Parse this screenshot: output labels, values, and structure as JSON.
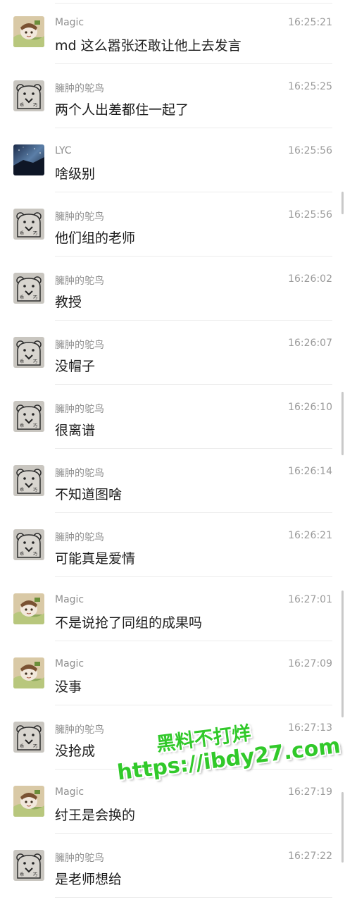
{
  "messages": [
    {
      "sender": "Magic",
      "time": "16:25:21",
      "text": "md 这么嚣张还敢让他上去发言",
      "avatar": "anime-avatar"
    },
    {
      "sender": "臃肿的鸵鸟",
      "time": "16:25:25",
      "text": "两个人出差都住一起了",
      "avatar": "bear-avatar"
    },
    {
      "sender": "LYC",
      "time": "16:25:56",
      "text": "啥级别",
      "avatar": "galaxy-avatar"
    },
    {
      "sender": "臃肿的鸵鸟",
      "time": "16:25:56",
      "text": "他们组的老师",
      "avatar": "bear-avatar"
    },
    {
      "sender": "臃肿的鸵鸟",
      "time": "16:26:02",
      "text": "教授",
      "avatar": "bear-avatar"
    },
    {
      "sender": "臃肿的鸵鸟",
      "time": "16:26:07",
      "text": "没帽子",
      "avatar": "bear-avatar"
    },
    {
      "sender": "臃肿的鸵鸟",
      "time": "16:26:10",
      "text": "很离谱",
      "avatar": "bear-avatar"
    },
    {
      "sender": "臃肿的鸵鸟",
      "time": "16:26:14",
      "text": "不知道图啥",
      "avatar": "bear-avatar"
    },
    {
      "sender": "臃肿的鸵鸟",
      "time": "16:26:21",
      "text": "可能真是爱情",
      "avatar": "bear-avatar"
    },
    {
      "sender": "Magic",
      "time": "16:27:01",
      "text": "不是说抢了同组的成果吗",
      "avatar": "anime-avatar"
    },
    {
      "sender": "Magic",
      "time": "16:27:09",
      "text": "没事",
      "avatar": "anime-avatar"
    },
    {
      "sender": "臃肿的鸵鸟",
      "time": "16:27:13",
      "text": "没抢成",
      "avatar": "bear-avatar"
    },
    {
      "sender": "Magic",
      "time": "16:27:19",
      "text": "纣王是会换的",
      "avatar": "anime-avatar"
    },
    {
      "sender": "臃肿的鸵鸟",
      "time": "16:27:22",
      "text": "是老师想给",
      "avatar": "bear-avatar"
    }
  ],
  "watermark": {
    "line1": "黑料不打烊",
    "line2": "https://ibdy27.com",
    "color": "#31c92a"
  },
  "colors": {
    "sender": "#8e8e8e",
    "time": "#9a9a9a",
    "text": "#1c1c1c",
    "divider": "#ececec"
  }
}
